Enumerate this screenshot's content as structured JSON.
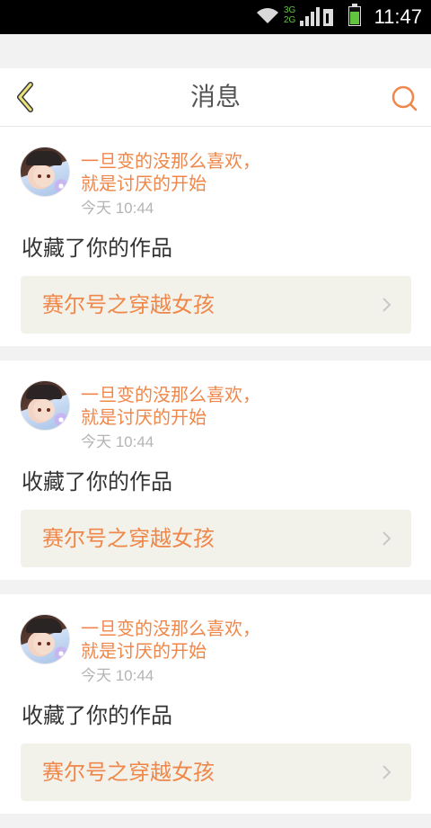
{
  "status_bar": {
    "network": "3G\n2G",
    "time": "11:47",
    "battery_level": 0.7
  },
  "header": {
    "title": "消息",
    "back_icon": "back-chevron-icon",
    "search_icon": "search-icon",
    "accent_color": "#f0874a"
  },
  "messages": [
    {
      "username": "一旦变的没那么喜欢，就是讨厌的开始",
      "time": "今天 10:44",
      "action": "收藏了你的作品",
      "work_title": "赛尔号之穿越女孩"
    },
    {
      "username": "一旦变的没那么喜欢，就是讨厌的开始",
      "time": "今天 10:44",
      "action": "收藏了你的作品",
      "work_title": "赛尔号之穿越女孩"
    },
    {
      "username": "一旦变的没那么喜欢，就是讨厌的开始",
      "time": "今天 10:44",
      "action": "收藏了你的作品",
      "work_title": "赛尔号之穿越女孩"
    }
  ]
}
